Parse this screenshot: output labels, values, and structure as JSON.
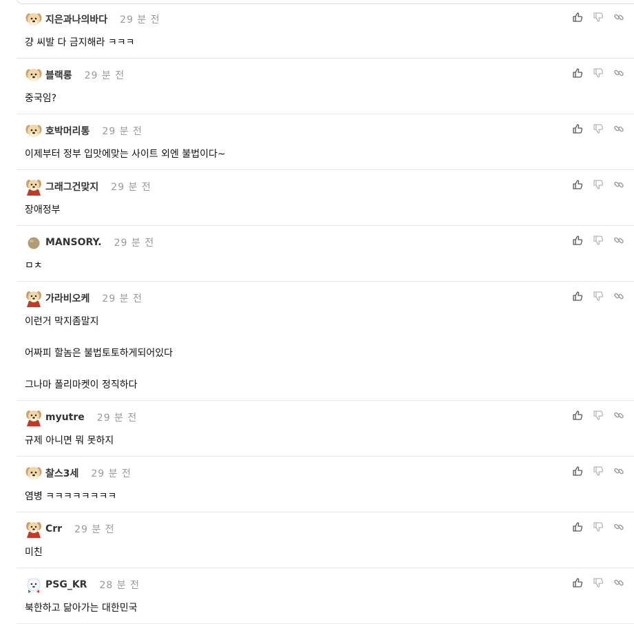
{
  "comments": [
    {
      "nickname": "지은과나의바다",
      "time": "29 분 전",
      "avatar": "dog-icon",
      "text": "걍 씨발 다 금지해라 ㅋㅋㅋ"
    },
    {
      "nickname": "블랙롱",
      "time": "29 분 전",
      "avatar": "dog-icon",
      "text": "중국임?"
    },
    {
      "nickname": "호박머리통",
      "time": "29 분 전",
      "avatar": "dog-icon",
      "text": "이제부터 정부 입맛에맞는 사이트 외엔 불법이다~"
    },
    {
      "nickname": "그래그건맞지",
      "time": "29 분 전",
      "avatar": "dog-cape-icon",
      "text": "장애정부"
    },
    {
      "nickname": "MANSORY.",
      "time": "29 분 전",
      "avatar": "ball-icon",
      "text": "ㅁㅊ"
    },
    {
      "nickname": "가라비오케",
      "time": "29 분 전",
      "avatar": "dog-cape-icon",
      "text": "이런거 막지좀말지\n\n어짜피 할놈은 불법토토하게되어있다\n\n그나마 폴리마켓이 정직하다"
    },
    {
      "nickname": "myutre",
      "time": "29 분 전",
      "avatar": "dog-cape-icon",
      "text": "규제 아니면 뭐 못하지"
    },
    {
      "nickname": "찰스3세",
      "time": "29 분 전",
      "avatar": "dog-icon",
      "text": "염병 ㅋㅋㅋㅋㅋㅋㅋㅋ"
    },
    {
      "nickname": "Crr",
      "time": "29 분 전",
      "avatar": "dog-cape-icon",
      "text": "미친"
    },
    {
      "nickname": "PSG_KR",
      "time": "28 분 전",
      "avatar": "white-bear-icon",
      "text": "북한하고 닮아가는 대한민국"
    }
  ],
  "colors": {
    "nickname": "#333333",
    "time": "#999999",
    "divider": "#e8e8e8",
    "icon": "#9a9a9a"
  }
}
